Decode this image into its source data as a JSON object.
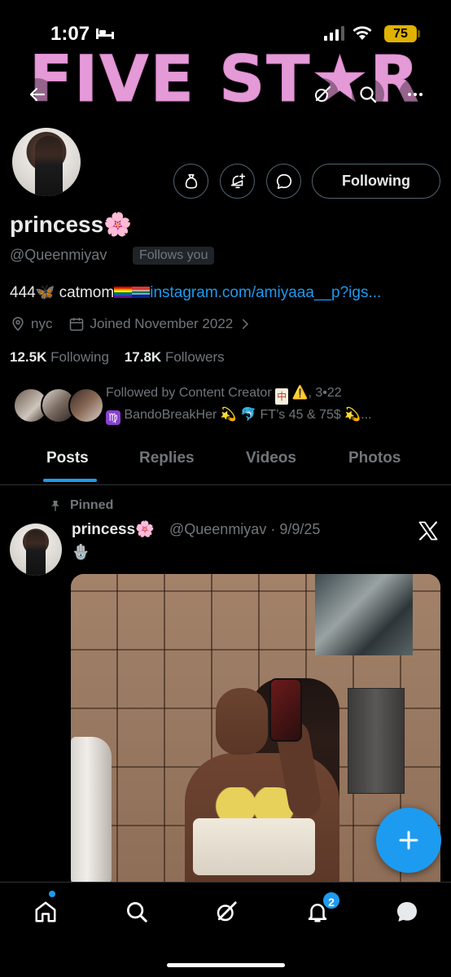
{
  "status_bar": {
    "time": "1:07",
    "battery": "75"
  },
  "header": {
    "banner_text": "FIVE ST★R"
  },
  "profile": {
    "display_name": "princess🌸",
    "handle": "@Queenmiyav",
    "follows_you": "Follows you",
    "bio_prefix": "444🦋 catmom",
    "bio_link": "instagram.com/amiyaaa__p?igs...",
    "location": "nyc",
    "joined": "Joined November 2022",
    "following_count": "12.5K",
    "following_label": "Following",
    "followers_count": "17.8K",
    "followers_label": "Followers",
    "followed_by_line1": "Followed by Content Creator",
    "followed_by_line1_suffix": "⚠️, 3•22",
    "followed_by_line2": "BandoBreakHer 💫 🐬 FT’s 45 & 75$ 💫...",
    "following_button": "Following"
  },
  "tabs": [
    "Posts",
    "Replies",
    "Videos",
    "Photos"
  ],
  "post": {
    "pinned_label": "Pinned",
    "name": "princess🌸",
    "meta": "@Queenmiyav · 9/9/25",
    "emoji_line": "🪬"
  },
  "bottom_nav": {
    "notif_count": "2"
  },
  "colors": {
    "accent": "#1d9bf0",
    "banner_pink": "#e59ad8",
    "muted": "#71767b"
  }
}
